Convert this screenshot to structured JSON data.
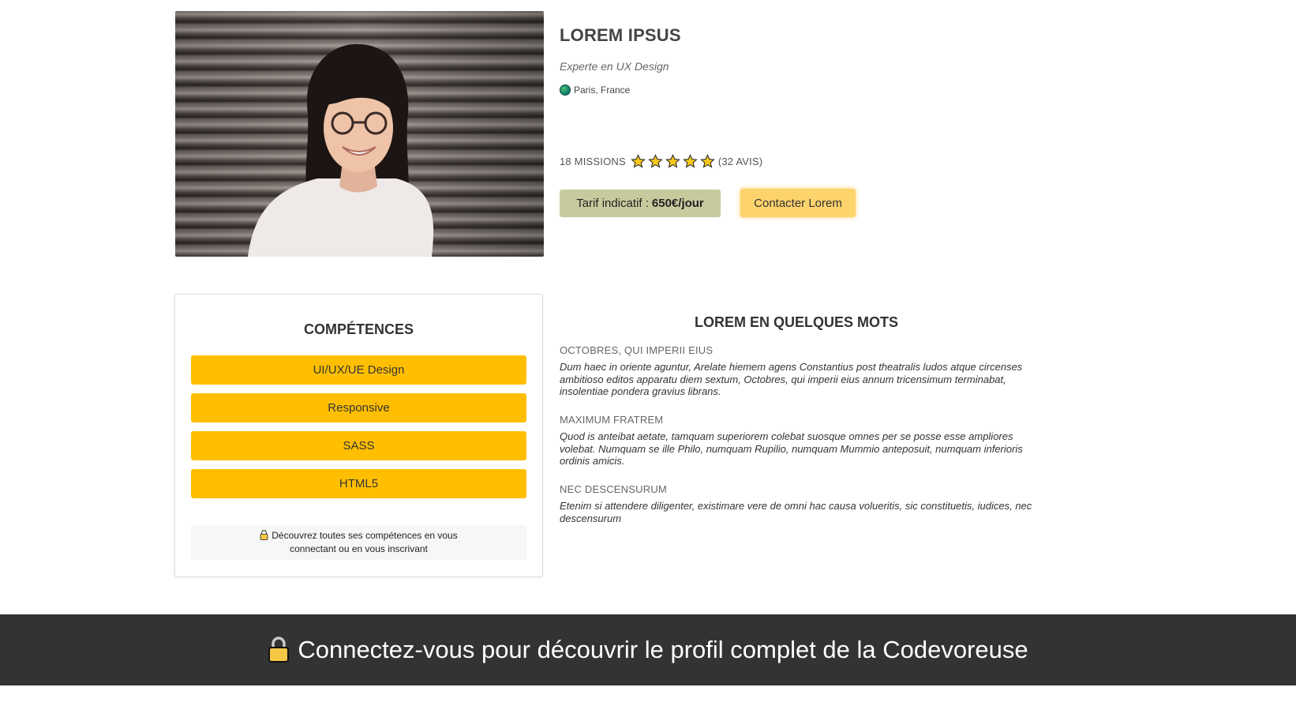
{
  "profile": {
    "name": "LOREM IPSUS",
    "role": "Experte en UX Design",
    "location": "Paris, France",
    "missions": "18 MISSIONS",
    "reviews": "(32 AVIS)",
    "rating": 5,
    "tarif_label": "Tarif indicatif :",
    "tarif_value": "650€/jour",
    "contact_label": "Contacter Lorem"
  },
  "skills": {
    "title": "COMPÉTENCES",
    "items": [
      "UI/UX/UE Design",
      "Responsive",
      "SASS",
      "HTML5"
    ],
    "lock_note": "Découvrez toutes ses compétences en vous connectant ou en vous inscrivant"
  },
  "about": {
    "title": "LOREM EN QUELQUES MOTS",
    "blocks": [
      {
        "head": "OCTOBRES, QUI IMPERII EIUS",
        "text": "Dum haec in oriente aguntur, Arelate hiemem agens Constantius post theatralis ludos atque circenses ambitioso editos apparatu diem sextum, Octobres, qui imperii eius annum tricensimum terminabat, insolentiae pondera gravius librans."
      },
      {
        "head": "MAXIMUM FRATREM",
        "text": "Quod is anteibat aetate, tamquam superiorem colebat suosque omnes per se posse esse ampliores volebat. Numquam se ille Philo, numquam Rupilio, numquam Mummio anteposuit, numquam inferioris ordinis amicis."
      },
      {
        "head": "NEC DESCENSURUM",
        "text": "Etenim si attendere diligenter, existimare vere de omni hac causa volueritis, sic constituetis, iudices, nec descensurum"
      }
    ]
  },
  "footer": {
    "text": "Connectez-vous pour découvrir le profil complet de la Codevoreuse"
  },
  "colors": {
    "skill_bg": "#ffbf00",
    "contact_bg": "#fdd36c",
    "tarif_bg": "#c8ca9e",
    "footer_bg": "#333333"
  }
}
